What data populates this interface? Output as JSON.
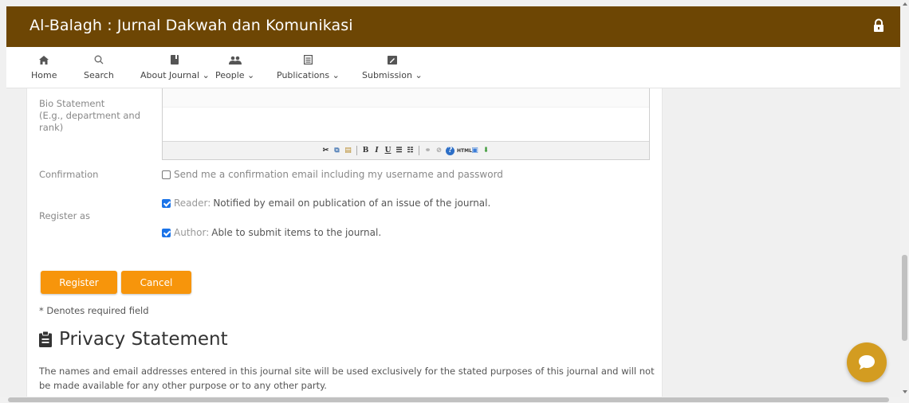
{
  "header": {
    "site_title": "Al-Balagh : Jurnal Dakwah dan Komunikasi",
    "lock_icon": "lock-icon",
    "bar_color": "#6d4604"
  },
  "nav": [
    {
      "label": "Home",
      "icon": "home-icon"
    },
    {
      "label": "Search",
      "icon": "search-icon"
    },
    {
      "label": "About Journal",
      "icon": "book-icon",
      "dropdown": true
    },
    {
      "label": "People",
      "icon": "people-icon",
      "dropdown": true
    },
    {
      "label": "Publications",
      "icon": "list-icon",
      "dropdown": true
    },
    {
      "label": "Submission",
      "icon": "edit-icon",
      "dropdown": true
    }
  ],
  "form": {
    "bio_label": "Bio Statement\n(E.g., department and rank)",
    "confirmation_label": "Confirmation",
    "confirmation_text": "Send me a confirmation email including my username and password",
    "confirmation_checked": false,
    "register_as_label": "Register as",
    "reader_role": "Reader:",
    "reader_desc": "Notified by email on publication of an issue of the journal.",
    "reader_checked": true,
    "author_role": "Author:",
    "author_desc": "Able to submit items to the journal.",
    "author_checked": true,
    "register_button": "Register",
    "cancel_button": "Cancel",
    "required_note": "* Denotes required field"
  },
  "privacy": {
    "title": "Privacy Statement",
    "text": "The names and email addresses entered in this journal site will be used exclusively for the stated purposes of this journal and will not be made available for any other purpose or to any other party."
  },
  "colors": {
    "accent_button": "#f7950b",
    "chat_button": "#d39c21",
    "checkbox": "#1a73e8"
  }
}
